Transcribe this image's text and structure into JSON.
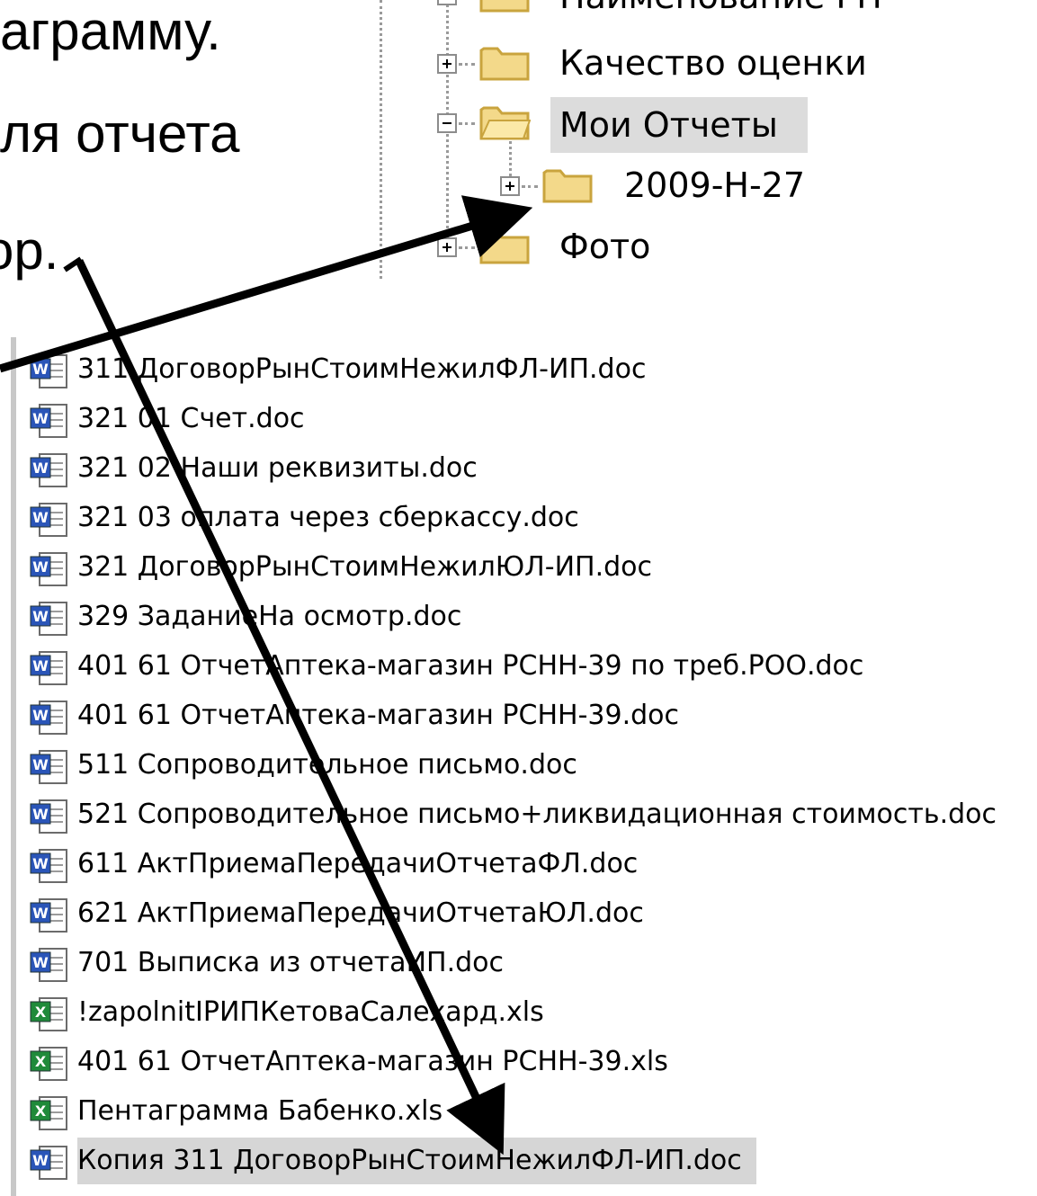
{
  "slide_text": {
    "line1": "аграмму.",
    "line2": "ля отчета",
    "line3": "ор."
  },
  "tree": {
    "items": [
      {
        "label": "Наименование РП",
        "expander": "plus",
        "selected": false,
        "partial": true
      },
      {
        "label": "Качество оценки",
        "expander": "plus",
        "selected": false
      },
      {
        "label": "Мои Отчеты",
        "expander": "minus",
        "selected": true
      },
      {
        "label": "2009-Н-27",
        "expander": "plus",
        "selected": false,
        "child": true
      },
      {
        "label": "Фото",
        "expander": "plus",
        "selected": false
      }
    ]
  },
  "files": [
    {
      "name": "311 ДоговорРынСтоимНежилФЛ-ИП.doc",
      "type": "word"
    },
    {
      "name": "321 01 Счет.doc",
      "type": "word"
    },
    {
      "name": "321 02 Наши реквизиты.doc",
      "type": "word"
    },
    {
      "name": "321 03 оплата через сберкассу.doc",
      "type": "word"
    },
    {
      "name": "321 ДоговорРынСтоимНежилЮЛ-ИП.doc",
      "type": "word"
    },
    {
      "name": "329 ЗаданиеНа осмотр.doc",
      "type": "word"
    },
    {
      "name": "401 61 ОтчетАптека-магазин  РСНН-39 по треб.РОО.doc",
      "type": "word"
    },
    {
      "name": "401 61 ОтчетАптека-магазин РСНН-39.doc",
      "type": "word"
    },
    {
      "name": "511 Сопроводительное письмо.doc",
      "type": "word"
    },
    {
      "name": "521 Сопроводительное письмо+ликвидационная стоимость.doc",
      "type": "word"
    },
    {
      "name": "611 АктПриемаПередачиОтчетаФЛ.doc",
      "type": "word"
    },
    {
      "name": "621 АктПриемаПередачиОтчетаЮЛ.doc",
      "type": "word"
    },
    {
      "name": "701 Выписка из отчетаИП.doc",
      "type": "word"
    },
    {
      "name": "!zapolnitIPИПКетоваСалехард.xls",
      "type": "excel"
    },
    {
      "name": "401 61 ОтчетАптека-магазин РСНН-39.xls",
      "type": "excel"
    },
    {
      "name": "Пентаграмма Бабенко.xls",
      "type": "excel"
    },
    {
      "name": "Копия 311 ДоговорРынСтоимНежилФЛ-ИП.doc",
      "type": "word",
      "selected": true
    }
  ],
  "colors": {
    "folder_fill": "#f3d98a",
    "folder_edge": "#c9a43e",
    "selection": "#d6d6d6",
    "arrow": "#000000"
  }
}
